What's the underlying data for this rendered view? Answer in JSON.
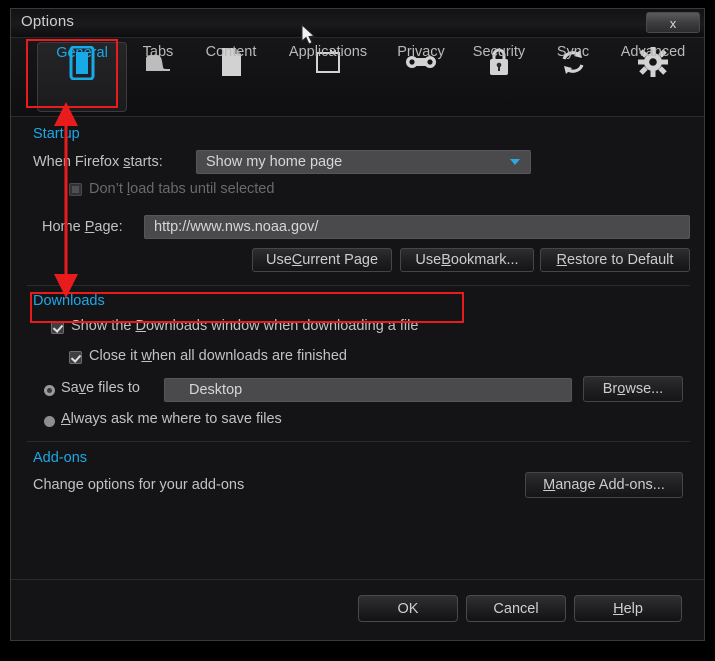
{
  "window": {
    "title": "Options",
    "close_label": "x"
  },
  "tabs": [
    {
      "label": "General",
      "icon": "general-panel-icon",
      "selected": true
    },
    {
      "label": "Tabs",
      "icon": "tabs-icon",
      "selected": false
    },
    {
      "label": "Content",
      "icon": "document-icon",
      "selected": false
    },
    {
      "label": "Applications",
      "icon": "window-icon",
      "selected": false
    },
    {
      "label": "Privacy",
      "icon": "mask-infinity-icon",
      "selected": false
    },
    {
      "label": "Security",
      "icon": "padlock-icon",
      "selected": false
    },
    {
      "label": "Sync",
      "icon": "sync-refresh-icon",
      "selected": false
    },
    {
      "label": "Advanced",
      "icon": "gear-icon",
      "selected": false
    }
  ],
  "startup": {
    "section_title": "Startup",
    "when_firefox_starts_label": "When Firefox starts:",
    "when_firefox_starts_mnemonic": "s",
    "startup_value": "Show my home page",
    "dont_load_tabs_label": "Don’t load tabs until selected",
    "dont_load_tabs_mnemonic": "l",
    "dont_load_tabs_checked": false,
    "dont_load_tabs_disabled": true,
    "home_page_label": "Home Page:",
    "home_page_mnemonic": "P",
    "home_page_value": "http://www.nws.noaa.gov/",
    "use_current_page_label": "Use Current Page",
    "use_current_page_mnemonic": "C",
    "use_bookmark_label": "Use Bookmark...",
    "use_bookmark_mnemonic": "B",
    "restore_default_label": "Restore to Default",
    "restore_default_mnemonic": "R"
  },
  "downloads": {
    "section_title": "Downloads",
    "show_downloads_window_label": "Show the Downloads window when downloading a file",
    "show_downloads_window_mnemonic": "D",
    "show_downloads_window_checked": true,
    "close_when_finished_label": "Close it when all downloads are finished",
    "close_when_finished_mnemonic": "w",
    "close_when_finished_checked": true,
    "save_files_to_label": "Save files to",
    "save_files_to_mnemonic": "v",
    "save_files_to_selected": true,
    "save_files_to_value": "Desktop",
    "browse_label": "Browse...",
    "browse_mnemonic": "o",
    "always_ask_label": "Always ask me where to save files",
    "always_ask_mnemonic": "A",
    "always_ask_selected": false
  },
  "addons": {
    "section_title": "Add-ons",
    "description": "Change options for your add-ons",
    "manage_label": "Manage Add-ons...",
    "manage_mnemonic": "M"
  },
  "footer": {
    "ok_label": "OK",
    "cancel_label": "Cancel",
    "help_label": "Help",
    "help_mnemonic": "H"
  },
  "annotations": {
    "highlight_color": "#e81c1c",
    "general_tab_box": "red rectangle around General tab",
    "downloads_checkbox_box": "red rectangle around Show the Downloads window checkbox",
    "arrow": "red double-headed vertical arrow from General tab down to Downloads checkbox"
  },
  "colors": {
    "accent": "#1ea7e6",
    "highlight": "#e81c1c",
    "window_bg": "#141416",
    "field_bg": "#4a4a4c"
  }
}
